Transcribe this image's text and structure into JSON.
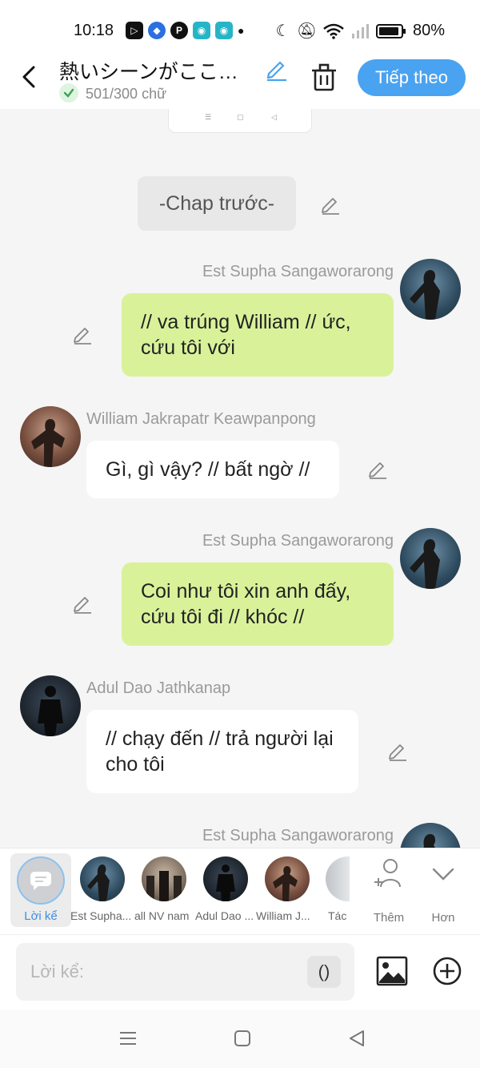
{
  "status": {
    "time": "10:18",
    "battery": "80%"
  },
  "header": {
    "title": "熱いシーンがここ…",
    "word_count": "501/300 chữ",
    "next_label": "Tiếp theo"
  },
  "chat": {
    "narration": "-Chap trước-",
    "messages": [
      {
        "side": "right",
        "speaker": "Est Supha Sangaworarong",
        "text": "// va trúng William // ức, cứu tôi với"
      },
      {
        "side": "left",
        "speaker": "William Jakrapatr Keawpanpong",
        "text": "Gì, gì vậy? // bất ngờ //"
      },
      {
        "side": "right",
        "speaker": "Est Supha Sangaworarong",
        "text": "Coi như tôi xin anh đấy, cứu tôi đi // khóc //"
      },
      {
        "side": "left",
        "speaker": "Adul Dao Jathkanap",
        "text": "// chạy đến // trả người lại cho tôi"
      },
      {
        "side": "right",
        "speaker": "Est Supha Sangaworarong",
        "text": ""
      }
    ]
  },
  "characters": {
    "selected_label": "Lời kể",
    "items": [
      {
        "label": "Est Supha..."
      },
      {
        "label": "all NV nam"
      },
      {
        "label": "Adul Dao ..."
      },
      {
        "label": "William J..."
      },
      {
        "label": "Tác"
      }
    ],
    "add_label": "Thêm",
    "more_label": "Hơn"
  },
  "composer": {
    "placeholder": "Lời kể:",
    "paren_label": "()"
  },
  "colors": {
    "accent": "#4aa3f0",
    "bubble_right": "#d9f29a",
    "bubble_left": "#ffffff",
    "background": "#f5f5f5"
  }
}
